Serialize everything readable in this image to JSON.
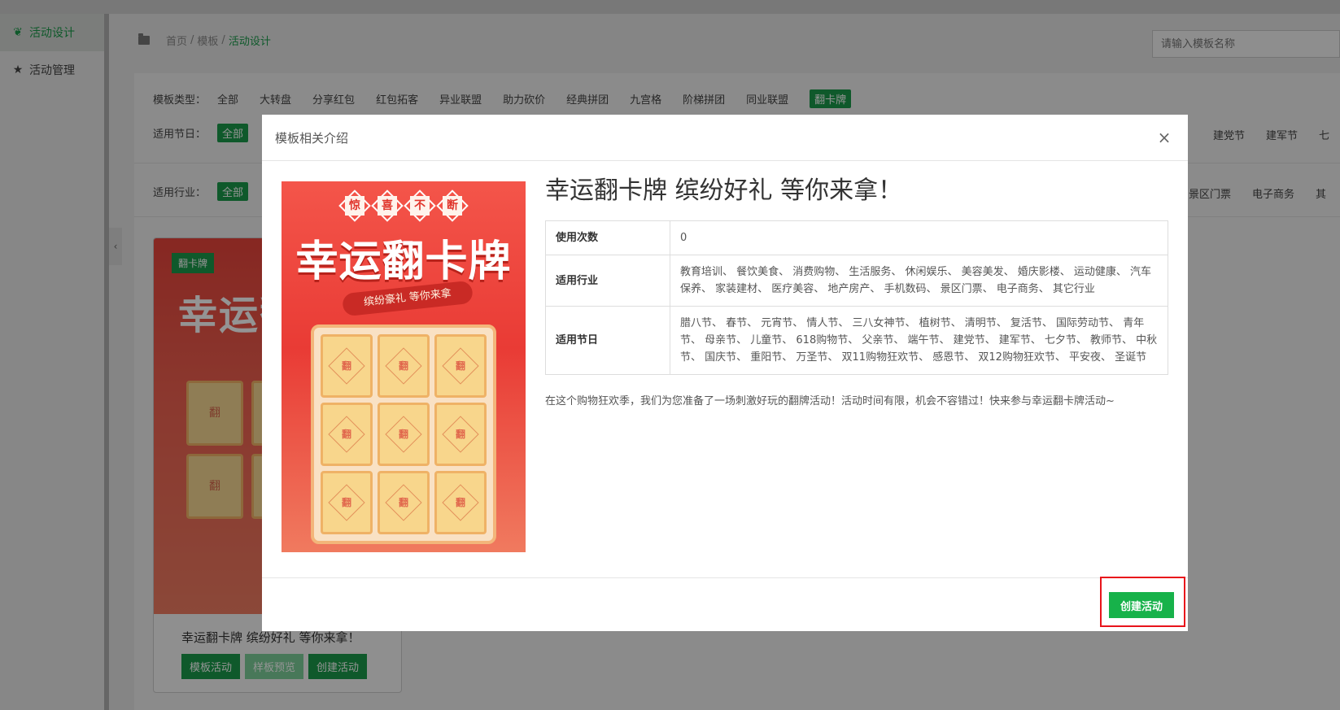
{
  "sidebar": {
    "items": [
      {
        "label": "活动设计",
        "icon": "leaf-icon",
        "active": true
      },
      {
        "label": "活动管理",
        "icon": "star-icon",
        "active": false
      }
    ]
  },
  "breadcrumb": {
    "home": "首页",
    "sep": "/",
    "level2": "模板",
    "current": "活动设计"
  },
  "search": {
    "placeholder": "请输入模板名称"
  },
  "filters": {
    "type": {
      "label": "模板类型：",
      "options": [
        "全部",
        "大转盘",
        "分享红包",
        "红包拓客",
        "异业联盟",
        "助力砍价",
        "经典拼团",
        "九宫格",
        "阶梯拼团",
        "同业联盟",
        "翻卡牌"
      ],
      "selected": "翻卡牌"
    },
    "holiday": {
      "label": "适用节日：",
      "all": "全部",
      "right_options": [
        "建党节",
        "建军节",
        "七"
      ]
    },
    "industry": {
      "label": "适用行业：",
      "all": "全部",
      "right_options": [
        "景区门票",
        "电子商务",
        "其"
      ]
    }
  },
  "card": {
    "badge": "翻卡牌",
    "caption": "幸运翻卡牌 缤纷好礼 等你来拿！",
    "buttons": [
      "模板活动",
      "样板预览",
      "创建活动"
    ]
  },
  "modal": {
    "title": "模板相关介绍",
    "close": "×",
    "poster": {
      "tagline": [
        "惊",
        "喜",
        "不",
        "断"
      ],
      "big": "幸运翻卡牌",
      "ribbon": "缤纷豪礼 等你来拿",
      "tile": "翻"
    },
    "heading": "幸运翻卡牌 缤纷好礼 等你来拿！",
    "rows": [
      {
        "key": "使用次数",
        "value": "0"
      },
      {
        "key": "适用行业",
        "value": "教育培训、 餐饮美食、 消费购物、 生活服务、 休闲娱乐、 美容美发、 婚庆影楼、 运动健康、 汽车保养、 家装建材、 医疗美容、 地产房产、 手机数码、 景区门票、 电子商务、 其它行业"
      },
      {
        "key": "适用节日",
        "value": "腊八节、 春节、 元宵节、 情人节、 三八女神节、 植树节、 清明节、 复活节、 国际劳动节、 青年节、 母亲节、 儿童节、 618购物节、 父亲节、 端午节、 建党节、 建军节、 七夕节、 教师节、 中秋节、 国庆节、 重阳节、 万圣节、 双11购物狂欢节、 感恩节、 双12购物狂欢节、 平安夜、 圣诞节"
      }
    ],
    "description": "在这个购物狂欢季，我们为您准备了一场刺激好玩的翻牌活动！活动时间有限，机会不容错过！快来参与幸运翻卡牌活动~",
    "create_button": "创建活动"
  },
  "colors": {
    "brand_green": "#1a9a4a",
    "button_green": "#17b24a",
    "highlight_red": "#e8141b"
  }
}
